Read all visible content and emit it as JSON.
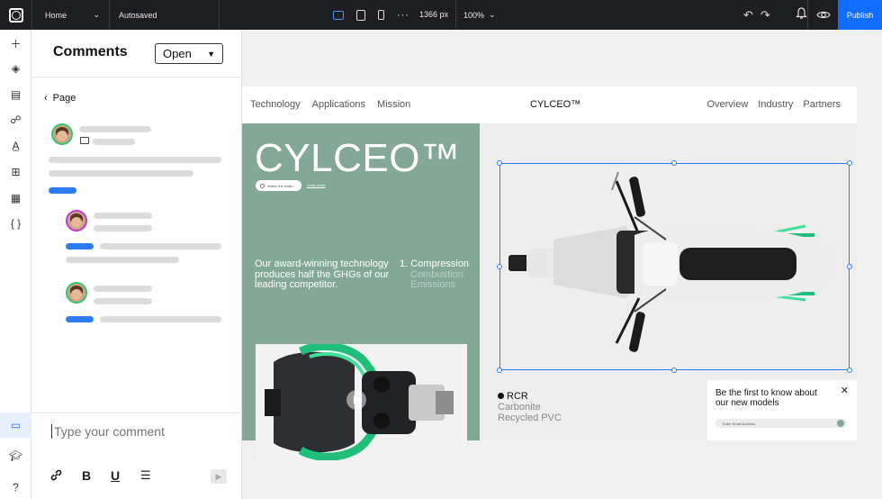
{
  "topbar": {
    "page_select": "Home",
    "save_status": "Autosaved",
    "viewport_width": "1366 px",
    "zoom": "100%",
    "publish": "Publish",
    "icons": [
      "undo-icon",
      "redo-icon",
      "bell-icon",
      "eye-icon"
    ]
  },
  "rail": {
    "items": [
      "add-icon",
      "layers-icon",
      "pages-icon",
      "design-icon",
      "text-theme-icon",
      "apps-icon",
      "table-icon",
      "code-icon",
      "comment-icon",
      "learn-icon",
      "help-icon"
    ]
  },
  "comments": {
    "title": "Comments",
    "filter": "Open",
    "back_label": "Page",
    "input_placeholder": "Type your comment",
    "toolbar": [
      "link-icon",
      "bold-icon",
      "underline-icon",
      "list-icon",
      "send-icon"
    ]
  },
  "site": {
    "nav_left": [
      "Technology",
      "Applications",
      "Mission"
    ],
    "brand": "CYLCEO™",
    "nav_right": [
      "Overview",
      "Industry",
      "Partners"
    ],
    "hero_title": "CYLCEO™",
    "watch_label": "Watch the trailer",
    "learn_more": "Learn more",
    "tagline": "Our award-winning technology produces half the GHGs of our leading competitor.",
    "list_number": "1.",
    "list_items": [
      "Compression",
      "Combustion",
      "Emissions"
    ],
    "rcr_title": "RCR",
    "rcr_lines": [
      "Carbonite",
      "Recycled PVC"
    ],
    "popup_text": "Be the first to know about our new models",
    "popup_placeholder": "Enter Email Address",
    "colors": {
      "sage": "#84a896",
      "accent": "#116dff",
      "selection": "#2e7bf6"
    }
  }
}
